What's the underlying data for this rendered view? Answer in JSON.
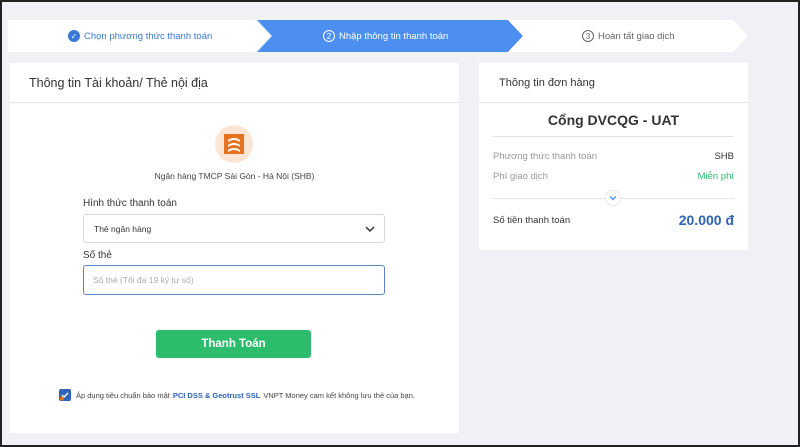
{
  "stepper": {
    "step1": "Chọn phương thức thanh toán",
    "step2": "Nhập thông tin thanh toán",
    "step3": "Hoàn tất giao dịch",
    "step2_num": "2",
    "step3_num": "3"
  },
  "payment_form": {
    "title": "Thông tin Tài khoản/ Thẻ nội địa",
    "bank_name": "Ngân hàng TMCP Sài Gòn - Hà Nội (SHB)",
    "method_label": "Hình thức thanh toán",
    "method_value": "Thẻ ngân hàng",
    "card_label": "Số thẻ",
    "card_value": "",
    "card_placeholder": "Số thẻ (Tối đa 19 ký tự số)",
    "pay_button": "Thanh Toán",
    "security_prefix": "Áp dụng tiêu chuẩn bảo mật",
    "security_highlight": "PCI DSS & Geotrust SSL",
    "security_suffix": "VNPT Money cam kết không lưu thẻ của bạn."
  },
  "order": {
    "title": "Thông tin đơn hàng",
    "gateway": "Cổng DVCQG - UAT",
    "method_key": "Phương thức thanh toán",
    "method_value": "SHB",
    "fee_key": "Phí giao dịch",
    "fee_value": "Miễn phí",
    "total_key": "Số tiền thanh toán",
    "total_value": "20.000 đ"
  },
  "colors": {
    "accent": "#4d8ff0",
    "button": "#2dbb6c",
    "total": "#2e63b8",
    "bank_logo": "#e8731e"
  },
  "icons": {
    "completed": "check-circle-icon",
    "dropdown": "chevron-down-icon",
    "expand": "chevron-down-icon",
    "security": "shield-icon"
  }
}
